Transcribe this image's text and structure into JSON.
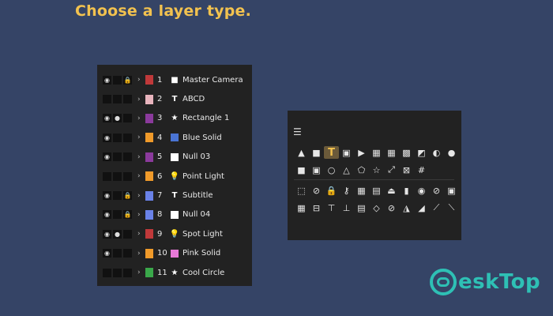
{
  "heading": "Choose a layer type.",
  "layers": [
    {
      "num": "1",
      "name": "Master Camera",
      "icon": "camera-icon",
      "glyph": "■",
      "color": "#c0393a",
      "eye": true,
      "dot": false,
      "lock": true
    },
    {
      "num": "2",
      "name": "ABCD",
      "icon": "text-icon",
      "glyph": "T",
      "color": "#e8b4bd",
      "eye": false,
      "dot": false,
      "lock": false
    },
    {
      "num": "3",
      "name": "Rectangle 1",
      "icon": "star-icon",
      "glyph": "★",
      "color": "#8b3a9c",
      "eye": true,
      "dot": true,
      "lock": false
    },
    {
      "num": "4",
      "name": "Blue Solid",
      "icon": "solid-icon",
      "glyph": "",
      "color": "#f09a2a",
      "eye": true,
      "dot": false,
      "lock": false,
      "solid": "#4a74d4"
    },
    {
      "num": "5",
      "name": "Null 03",
      "icon": "null-icon",
      "glyph": "",
      "color": "#8b3a9c",
      "eye": true,
      "dot": false,
      "lock": false,
      "solid": "#ffffff"
    },
    {
      "num": "6",
      "name": "Point Light",
      "icon": "bulb-icon",
      "glyph": "💡",
      "color": "#f09a2a",
      "eye": false,
      "dot": false,
      "lock": false
    },
    {
      "num": "7",
      "name": "Subtitle",
      "icon": "text-icon",
      "glyph": "T",
      "color": "#6a82e8",
      "eye": true,
      "dot": false,
      "lock": true
    },
    {
      "num": "8",
      "name": "Null 04",
      "icon": "null-icon",
      "glyph": "",
      "color": "#6a82e8",
      "eye": true,
      "dot": false,
      "lock": true,
      "solid": "#ffffff"
    },
    {
      "num": "9",
      "name": "Spot Light",
      "icon": "bulb-icon",
      "glyph": "💡",
      "color": "#c0393a",
      "eye": true,
      "dot": true,
      "lock": false
    },
    {
      "num": "10",
      "name": "Pink Solid",
      "icon": "solid-icon",
      "glyph": "",
      "color": "#f09a2a",
      "eye": true,
      "dot": false,
      "lock": false,
      "solid": "#e87ad8"
    },
    {
      "num": "11",
      "name": "Cool Circle",
      "icon": "star-icon",
      "glyph": "★",
      "color": "#3aa84a",
      "eye": false,
      "dot": false,
      "lock": false
    }
  ],
  "picker": {
    "rows": [
      [
        "▲",
        "■",
        "T",
        "▣",
        "▶",
        "▦",
        "▦",
        "▩",
        "◩",
        "◐",
        "●"
      ],
      [
        "■",
        "▣",
        "○",
        "△",
        "⬠",
        "☆",
        "⤢",
        "⊠",
        "#"
      ],
      [
        "⬚",
        "⊘",
        "🔒",
        "⚷",
        "▦",
        "▤",
        "⏏",
        "▮",
        "◉",
        "⊘",
        "▣"
      ],
      [
        "▦",
        "⊟",
        "⊤",
        "⊥",
        "▤",
        "◇",
        "⊘",
        "◮",
        "◢",
        "⟋",
        "⟍"
      ]
    ],
    "selected": "T"
  },
  "watermark": {
    "text": "eskTop"
  }
}
